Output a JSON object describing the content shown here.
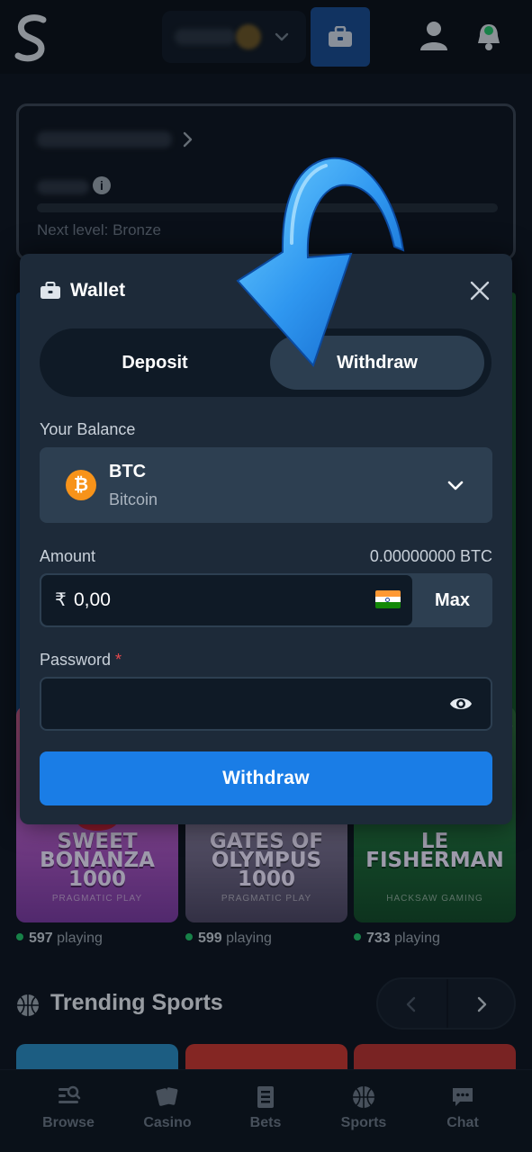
{
  "header": {
    "wallet_icon": "briefcase-icon",
    "user_icon": "user-icon",
    "bell_icon": "bell-icon"
  },
  "vip": {
    "next_level": "Next level: Bronze"
  },
  "games": [
    {
      "title": "SWEET BONANZA 1000",
      "provider": "PRAGMATIC PLAY",
      "playing_count": "597",
      "playing_label": "playing"
    },
    {
      "title": "GATES OF OLYMPUS 1000",
      "provider": "PRAGMATIC PLAY",
      "playing_count": "599",
      "playing_label": "playing"
    },
    {
      "title": "LE FISHERMAN",
      "provider": "HACKSAW GAMING",
      "playing_count": "733",
      "playing_label": "playing"
    }
  ],
  "trending": {
    "title": "Trending Sports"
  },
  "bottom_nav": [
    {
      "label": "Browse",
      "icon": "browse-icon"
    },
    {
      "label": "Casino",
      "icon": "cards-icon"
    },
    {
      "label": "Bets",
      "icon": "betslip-icon"
    },
    {
      "label": "Sports",
      "icon": "basketball-icon"
    },
    {
      "label": "Chat",
      "icon": "chat-icon"
    }
  ],
  "wallet_modal": {
    "title": "Wallet",
    "tabs": {
      "deposit": "Deposit",
      "withdraw": "Withdraw",
      "active": "withdraw"
    },
    "balance_label": "Your Balance",
    "currency": {
      "code": "BTC",
      "name": "Bitcoin",
      "symbol": "₿"
    },
    "amount_label": "Amount",
    "amount_available": "0.00000000 BTC",
    "amount_symbol": "₹",
    "amount_value": "0,00",
    "max_label": "Max",
    "password_label": "Password",
    "password_required_mark": "*",
    "submit_label": "Withdraw"
  },
  "colors": {
    "accent": "#1a7de6",
    "modal_bg": "#1d2a39",
    "btc": "#f7931a",
    "online": "#23c267"
  }
}
